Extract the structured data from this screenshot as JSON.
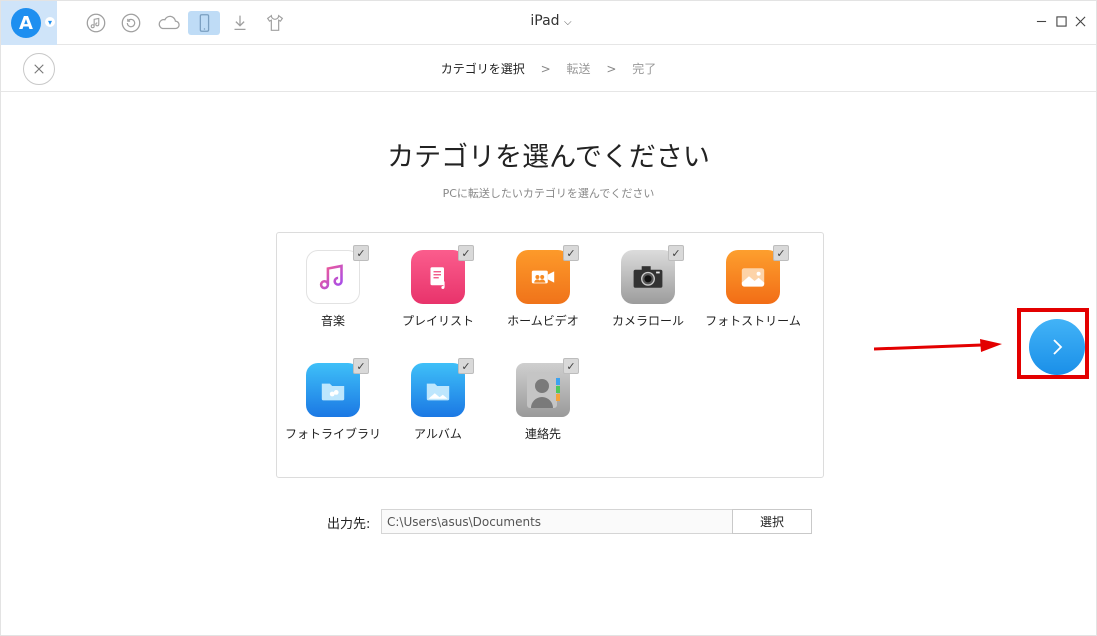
{
  "topbar": {
    "device_name": "iPad",
    "device_chevron": "chevron-down-icon",
    "tool_icons": [
      "music-icon",
      "restore-icon",
      "cloud-icon",
      "device-icon",
      "download-icon",
      "tshirt-icon"
    ]
  },
  "navbar": {
    "steps": [
      {
        "label": "カテゴリを選択",
        "current": true
      },
      {
        "label": "転送",
        "current": false
      },
      {
        "label": "完了",
        "current": false
      }
    ],
    "separator": ">"
  },
  "main": {
    "title": "カテゴリを選んでください",
    "subtitle": "PCに転送したいカテゴリを選んでください",
    "categories": [
      {
        "label": "音楽",
        "icon": "music-note-icon",
        "checked": true
      },
      {
        "label": "プレイリスト",
        "icon": "playlist-icon",
        "checked": true
      },
      {
        "label": "ホームビデオ",
        "icon": "home-video-icon",
        "checked": true
      },
      {
        "label": "カメラロール",
        "icon": "camera-icon",
        "checked": true
      },
      {
        "label": "フォトストリーム",
        "icon": "photostream-icon",
        "checked": true
      },
      {
        "label": "フォトライブラリ",
        "icon": "photo-library-icon",
        "checked": true
      },
      {
        "label": "アルバム",
        "icon": "album-icon",
        "checked": true
      },
      {
        "label": "連絡先",
        "icon": "contacts-icon",
        "checked": true
      }
    ],
    "output": {
      "label": "出力先:",
      "path": "C:\\Users\\asus\\Documents",
      "select_label": "選択"
    }
  },
  "colors": {
    "accent": "#1e8ff0",
    "highlight": "#e30000"
  }
}
